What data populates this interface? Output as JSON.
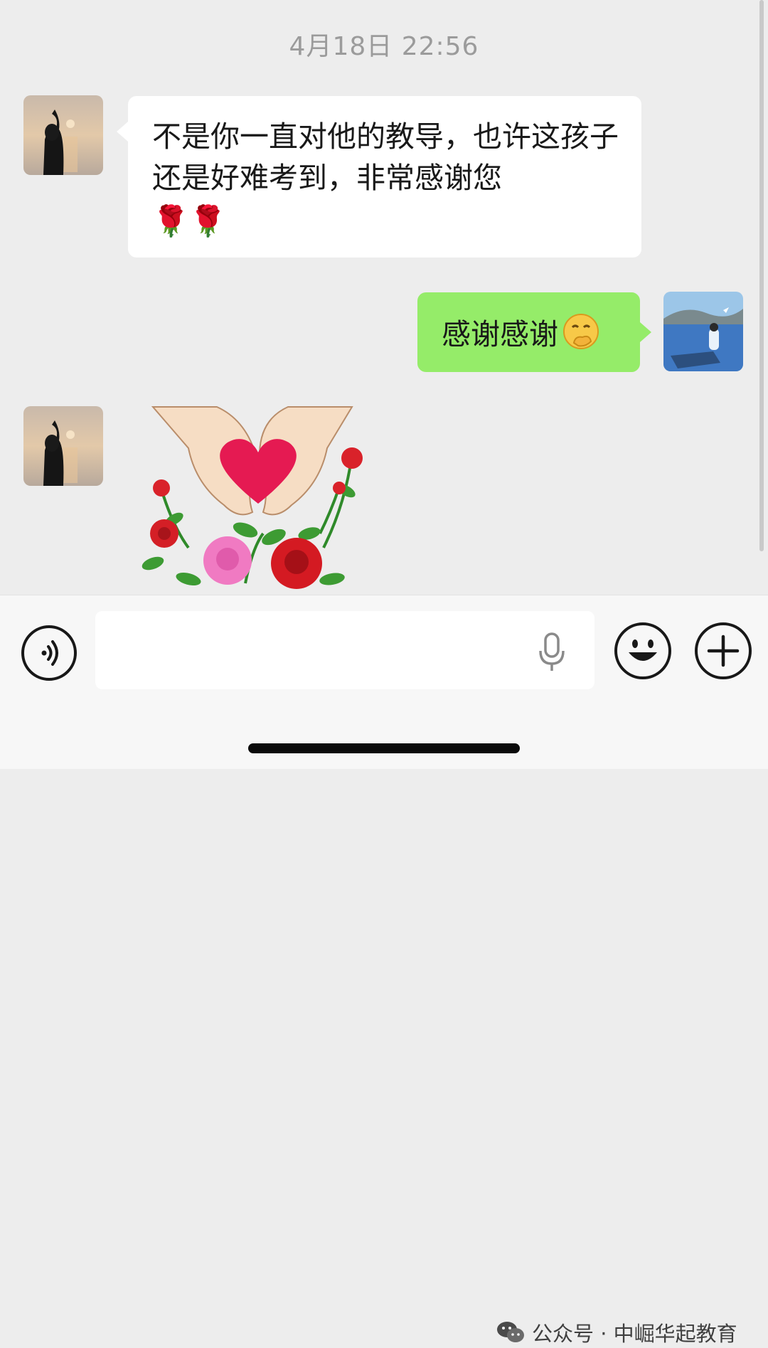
{
  "chat": {
    "timestamp": "4月18日 22:56",
    "messages": [
      {
        "side": "left",
        "text": "不是你一直对他的教导，也许这孩子还是好难考到，非常感谢您",
        "emoji": "🌹🌹"
      },
      {
        "side": "right",
        "text": "感谢感谢",
        "emoji": "smirk-hand-over-mouth-emoji"
      },
      {
        "side": "left",
        "type": "sticker",
        "sticker": "heart-hands-roses-sticker"
      }
    ]
  },
  "input_bar": {
    "voice_icon": "voice-mode-icon",
    "text_value": "",
    "mic_icon": "microphone-icon",
    "emoji_icon": "emoji-face-icon",
    "plus_icon": "plus-icon"
  },
  "watermark": {
    "label": "公众号 · 中崛华起教育",
    "icon": "wechat-logo-icon"
  },
  "colors": {
    "background": "#ededed",
    "bubble_incoming": "#ffffff",
    "bubble_outgoing": "#95ec69"
  }
}
